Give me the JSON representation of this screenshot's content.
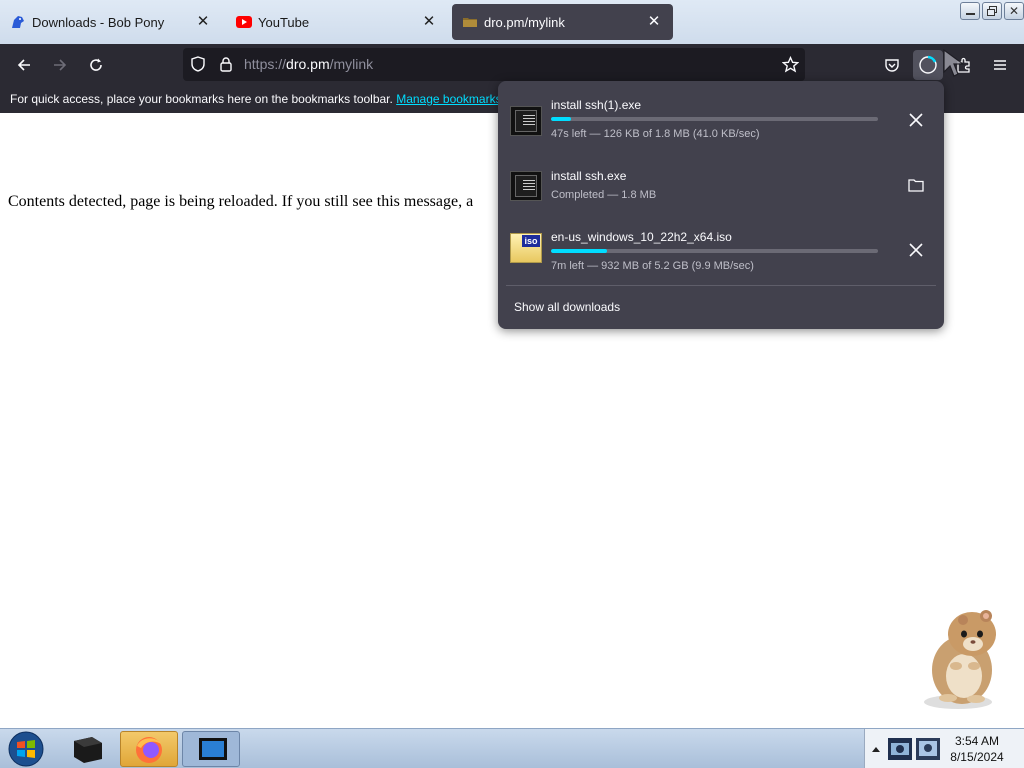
{
  "tabs": [
    {
      "title": "Downloads - Bob Pony",
      "icon": "bobpony-icon",
      "active": false
    },
    {
      "title": "YouTube",
      "icon": "youtube-icon",
      "active": false
    },
    {
      "title": "dro.pm/mylink",
      "icon": "folder-icon",
      "active": true
    }
  ],
  "url": {
    "scheme": "https://",
    "host": "dro.pm",
    "path": "/mylink"
  },
  "bookmarks_bar": {
    "text": "For quick access, place your bookmarks here on the bookmarks toolbar.",
    "link": "Manage bookmarks..."
  },
  "page": {
    "message": "Contents detected, page is being reloaded. If you still see this message, a"
  },
  "downloads": {
    "items": [
      {
        "name": "install ssh(1).exe",
        "status": "47s left — 126 KB of 1.8 MB (41.0 KB/sec)",
        "progress": 0.06,
        "action": "cancel",
        "icon": "exe-icon"
      },
      {
        "name": "install ssh.exe",
        "status": "Completed — 1.8 MB",
        "progress": null,
        "action": "show-in-folder",
        "icon": "exe-icon"
      },
      {
        "name": "en-us_windows_10_22h2_x64.iso",
        "status": "7m left — 932 MB of 5.2 GB (9.9 MB/sec)",
        "progress": 0.17,
        "action": "cancel",
        "icon": "iso-icon"
      }
    ],
    "show_all": "Show all downloads"
  },
  "taskbar": {
    "time": "3:54 AM",
    "date": "8/15/2024"
  },
  "colors": {
    "accent": "#00ddff",
    "toolbar": "#2b2a33",
    "panel": "#42414d"
  }
}
